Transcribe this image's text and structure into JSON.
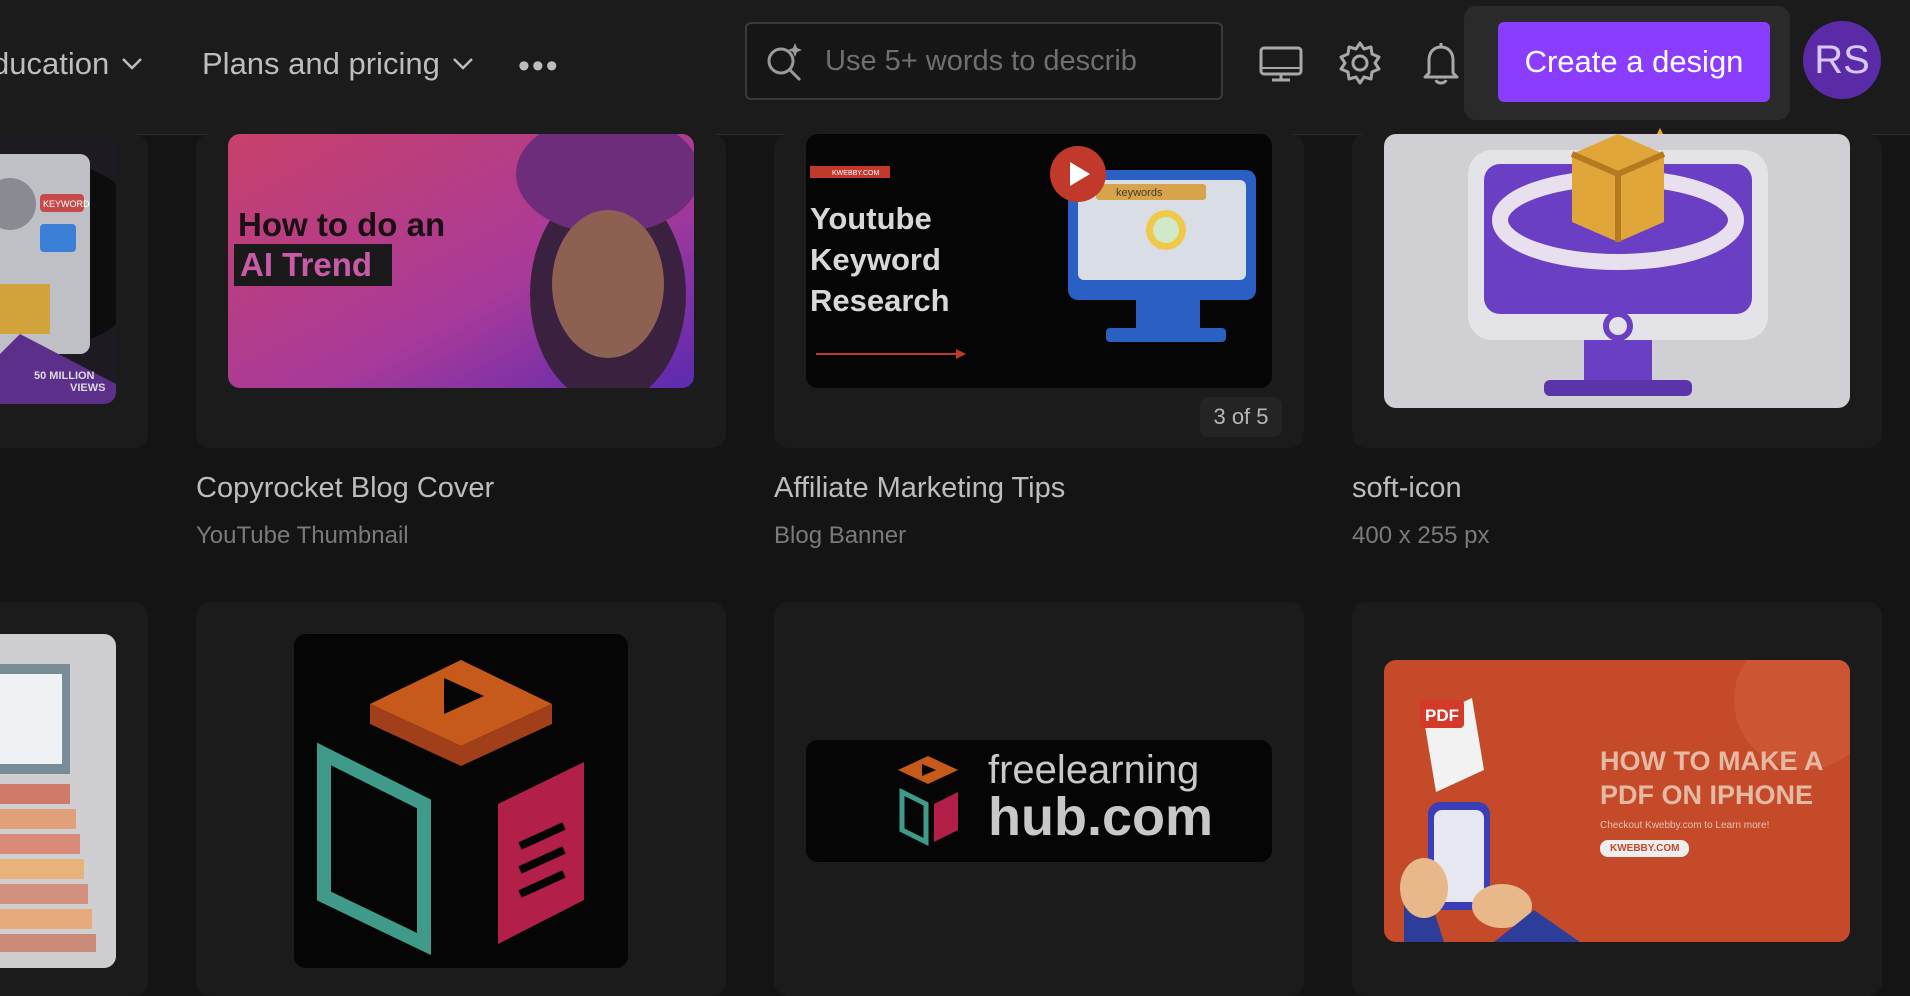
{
  "nav": {
    "education": "ducation",
    "plans": "Plans and pricing",
    "more": "•••"
  },
  "search": {
    "placeholder": "Use 5+ words to describ"
  },
  "header": {
    "create_label": "Create a design",
    "avatar_initials": "RS"
  },
  "cards": [
    {
      "title": "Copyrocket Blog Cover",
      "subtitle": "YouTube Thumbnail",
      "thumb_text": [
        "How to do an",
        "AI Trend"
      ]
    },
    {
      "title": "Affiliate Marketing Tips",
      "subtitle": "Blog Banner",
      "badge": "3 of 5",
      "thumb_text": [
        "KWEBBY.COM",
        "Youtube",
        "Keyword",
        "Research",
        "keywords"
      ]
    },
    {
      "title": "soft-icon",
      "subtitle": "400 x 255 px"
    }
  ],
  "left_card": {
    "thumb_text": [
      "KEYWORD",
      "50 MILLION",
      "VIEWS"
    ]
  },
  "row2": {
    "logo_card": {
      "line1": "freelearning",
      "line2": "hub.com"
    },
    "pdf_card": {
      "pdf_label": "PDF",
      "heading1": "HOW TO MAKE A",
      "heading2": "PDF ON IPHONE",
      "sub": "Checkout Kwebby.com to Learn more!",
      "tag": "KWEBBY.COM"
    }
  },
  "colors": {
    "accent": "#8b3dff",
    "arrow": "#f5a623"
  }
}
